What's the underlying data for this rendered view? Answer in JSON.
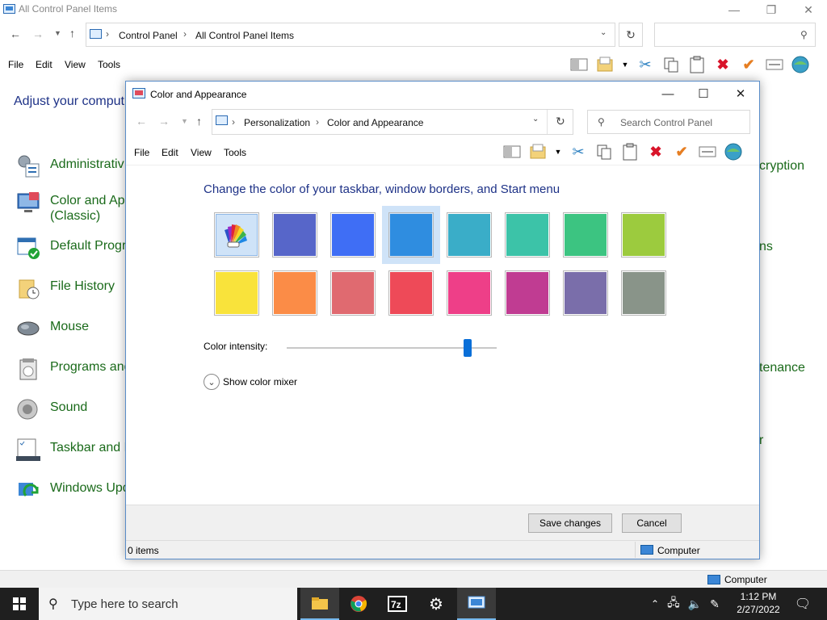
{
  "bg_window": {
    "title": "All Control Panel Items",
    "breadcrumbs": [
      "Control Panel",
      "All Control Panel Items"
    ],
    "menu": [
      "File",
      "Edit",
      "View",
      "Tools"
    ],
    "adjust_text": "Adjust your comput",
    "items": [
      {
        "label": "Administrativ",
        "icon": "admin-tools-icon"
      },
      {
        "label": "Color and App",
        "label2": "(Classic)",
        "icon": "color-appearance-icon"
      },
      {
        "label": "Default Progr",
        "icon": "default-programs-icon"
      },
      {
        "label": "File History",
        "icon": "file-history-icon"
      },
      {
        "label": "Mouse",
        "icon": "mouse-icon"
      },
      {
        "label": "Programs and",
        "icon": "programs-icon"
      },
      {
        "label": "Sound",
        "icon": "sound-icon"
      },
      {
        "label": "Taskbar and N",
        "icon": "taskbar-icon"
      },
      {
        "label": "Windows Upd",
        "icon": "windows-update-icon"
      }
    ],
    "right_fragments": [
      "cryption",
      "ns",
      "tenance",
      "r"
    ],
    "status_computer": "Computer"
  },
  "dialog": {
    "title": "Color and Appearance",
    "breadcrumbs": [
      "Personalization",
      "Color and Appearance"
    ],
    "search_placeholder": "Search Control Panel",
    "menu": [
      "File",
      "Edit",
      "View",
      "Tools"
    ],
    "heading": "Change the color of your taskbar, window borders, and Start menu",
    "colors": {
      "row1": [
        "auto",
        "#5766c9",
        "#3f6ef5",
        "#2f8de0",
        "#3aadc8",
        "#3cc3a8",
        "#3cc481",
        "#9ccb3e"
      ],
      "row2": [
        "#f9e33b",
        "#fb8c47",
        "#e06a70",
        "#ee4a58",
        "#ee3f88",
        "#c03c92",
        "#7a6eaa",
        "#899489"
      ],
      "selected_index": 3
    },
    "intensity_label": "Color intensity:",
    "intensity_value": 0.86,
    "mixer_label": "Show color mixer",
    "save_label": "Save changes",
    "cancel_label": "Cancel",
    "status_items": "0 items",
    "status_computer": "Computer"
  },
  "taskbar": {
    "search_placeholder": "Type here to search",
    "time": "1:12 PM",
    "date": "2/27/2022"
  }
}
